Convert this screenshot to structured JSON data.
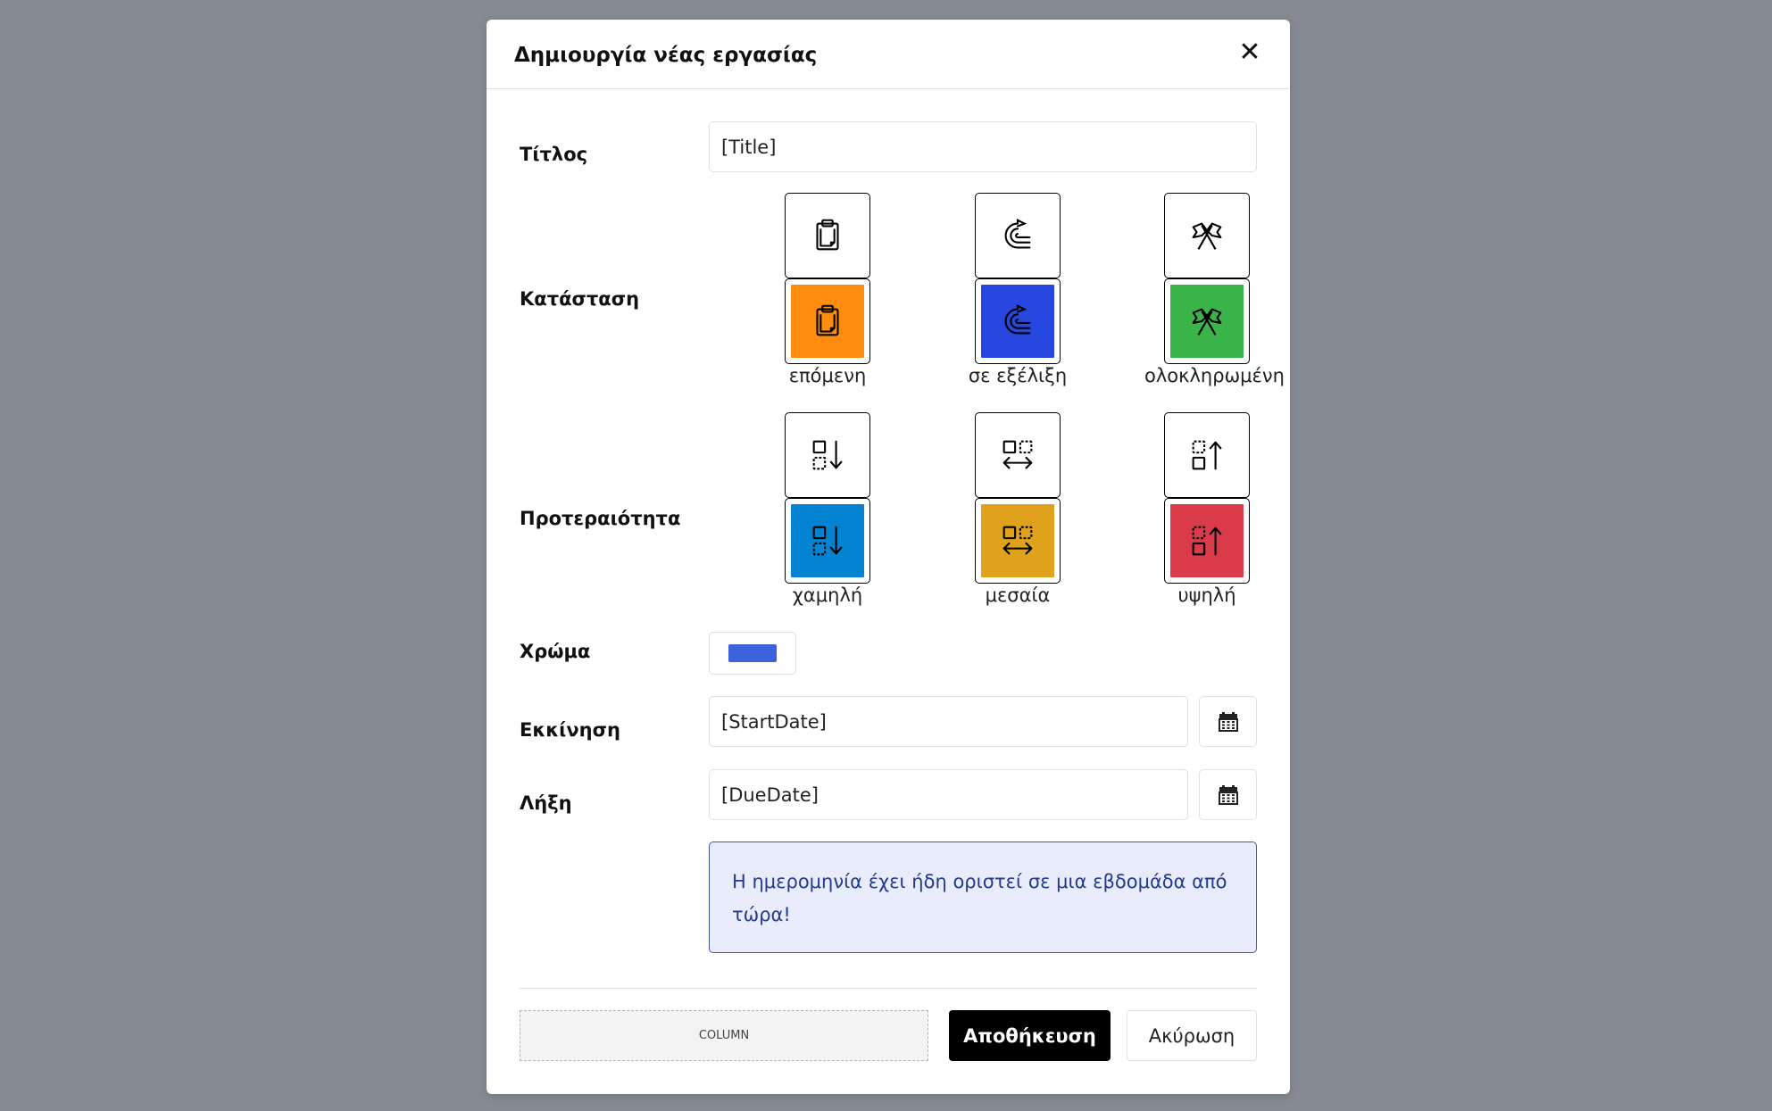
{
  "modal": {
    "title": "Δημιουργία νέας εργασίας",
    "close_icon": "close-icon"
  },
  "form": {
    "title_label": "Τίτλος",
    "title_value": "[Title]",
    "status_label": "Κατάσταση",
    "status_options": [
      {
        "label": "επόμενη",
        "icon": "clipboard-icon",
        "color": "#ff8c0f"
      },
      {
        "label": "σε εξέλιξη",
        "icon": "progress-arrow-icon",
        "color": "#2747e0"
      },
      {
        "label": "ολοκληρωμένη",
        "icon": "crossed-flags-icon",
        "color": "#3bb44a"
      }
    ],
    "priority_label": "Προτεραιότητα",
    "priority_options": [
      {
        "label": "χαμηλή",
        "icon": "priority-low-icon",
        "color": "#0483d3"
      },
      {
        "label": "μεσαία",
        "icon": "priority-medium-icon",
        "color": "#e0a21c"
      },
      {
        "label": "υψηλή",
        "icon": "priority-high-icon",
        "color": "#d93b4a"
      }
    ],
    "color_label": "Χρώμα",
    "color_value": "#3d62dc",
    "start_label": "Εκκίνηση",
    "start_value": "[StartDate]",
    "due_label": "Λήξη",
    "due_value": "[DueDate]",
    "calendar_icon": "calendar-icon",
    "alert_text": "Η ημερομηνία έχει ήδη οριστεί σε μια εβδομάδα από τώρα!"
  },
  "footer": {
    "column_placeholder": "COLUMN",
    "save_label": "Αποθήκευση",
    "cancel_label": "Ακύρωση"
  }
}
